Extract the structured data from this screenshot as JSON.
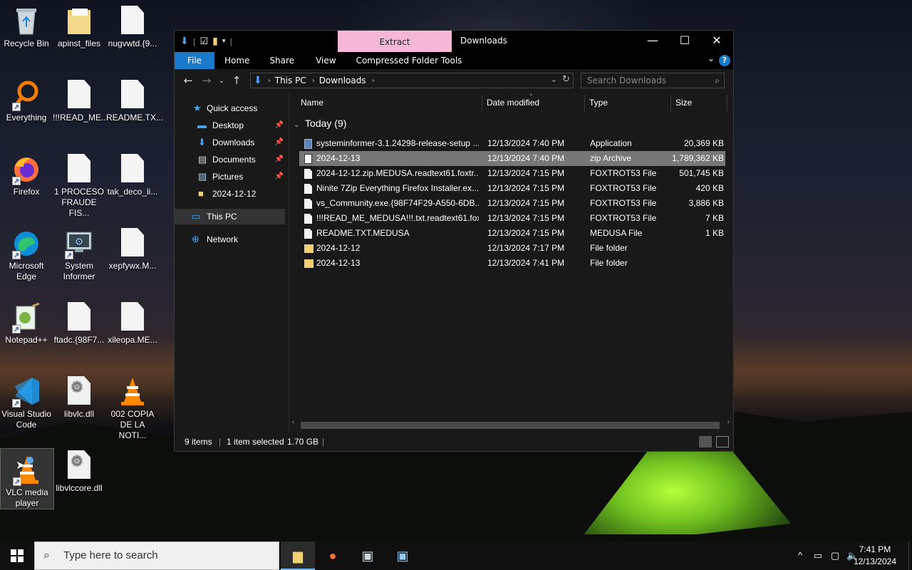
{
  "desktop": {
    "icons": [
      {
        "label": "Recycle Bin"
      },
      {
        "label": "apinst_files"
      },
      {
        "label": "nugvwtd.{9..."
      },
      {
        "label": "Everything"
      },
      {
        "label": "!!!READ_ME..."
      },
      {
        "label": "README.TX..."
      },
      {
        "label": "Firefox"
      },
      {
        "label": "1 PROCESO FRAUDE FIS..."
      },
      {
        "label": "tak_deco_li..."
      },
      {
        "label": "Microsoft Edge"
      },
      {
        "label": "System Informer"
      },
      {
        "label": "xepfywx.M..."
      },
      {
        "label": "Notepad++"
      },
      {
        "label": "ftadc.{98F7..."
      },
      {
        "label": "xileopa.ME..."
      },
      {
        "label": "Visual Studio Code"
      },
      {
        "label": "libvlc.dll"
      },
      {
        "label": "002 COPIA DE LA NOTI..."
      },
      {
        "label": "VLC media player"
      },
      {
        "label": "libvlccore.dll"
      }
    ]
  },
  "window": {
    "title": "Downloads",
    "context_tab": "Extract",
    "ribbon_tabs": [
      "File",
      "Home",
      "Share",
      "View",
      "Compressed Folder Tools"
    ],
    "breadcrumb": [
      "This PC",
      "Downloads"
    ],
    "search_placeholder": "Search Downloads"
  },
  "nav": {
    "items": [
      {
        "label": "Quick access",
        "icon": "star-icon"
      },
      {
        "label": "Desktop",
        "icon": "desktop-icon",
        "pinned": true
      },
      {
        "label": "Downloads",
        "icon": "download-icon",
        "pinned": true
      },
      {
        "label": "Documents",
        "icon": "documents-icon",
        "pinned": true
      },
      {
        "label": "Pictures",
        "icon": "pictures-icon",
        "pinned": true
      },
      {
        "label": "2024-12-12",
        "icon": "folder-icon"
      },
      {
        "label": "This PC",
        "icon": "computer-icon"
      },
      {
        "label": "Network",
        "icon": "network-icon"
      }
    ]
  },
  "list": {
    "columns": [
      "Name",
      "Date modified",
      "Type",
      "Size"
    ],
    "group": "Today (9)",
    "rows": [
      {
        "name": "systeminformer-3.1.24298-release-setup ...",
        "date": "12/13/2024 7:40 PM",
        "type": "Application",
        "size": "20,369 KB",
        "icon": "app"
      },
      {
        "name": "2024-12-13",
        "date": "12/13/2024 7:40 PM",
        "type": "zip Archive",
        "size": "1,789,362 KB",
        "icon": "zip"
      },
      {
        "name": "2024-12-12.zip.MEDUSA.readtext61.foxtr...",
        "date": "12/13/2024 7:15 PM",
        "type": "FOXTROT53 File",
        "size": "501,745 KB",
        "icon": "doc"
      },
      {
        "name": "Ninite 7Zip Everything Firefox Installer.ex...",
        "date": "12/13/2024 7:15 PM",
        "type": "FOXTROT53 File",
        "size": "420 KB",
        "icon": "doc"
      },
      {
        "name": "vs_Community.exe.{98F74F29-A550-6DB...",
        "date": "12/13/2024 7:15 PM",
        "type": "FOXTROT53 File",
        "size": "3,886 KB",
        "icon": "doc"
      },
      {
        "name": "!!!READ_ME_MEDUSA!!!.txt.readtext61.fox...",
        "date": "12/13/2024 7:15 PM",
        "type": "FOXTROT53 File",
        "size": "7 KB",
        "icon": "doc"
      },
      {
        "name": "README.TXT.MEDUSA",
        "date": "12/13/2024 7:15 PM",
        "type": "MEDUSA File",
        "size": "1 KB",
        "icon": "doc"
      },
      {
        "name": "2024-12-12",
        "date": "12/13/2024 7:17 PM",
        "type": "File folder",
        "size": "",
        "icon": "folder"
      },
      {
        "name": "2024-12-13",
        "date": "12/13/2024 7:41 PM",
        "type": "File folder",
        "size": "",
        "icon": "folder"
      }
    ]
  },
  "status": {
    "items": "9 items",
    "selected": "1 item selected",
    "size": "1.70 GB"
  },
  "taskbar": {
    "search_placeholder": "Type here to search",
    "time": "7:41 PM",
    "date": "12/13/2024"
  }
}
